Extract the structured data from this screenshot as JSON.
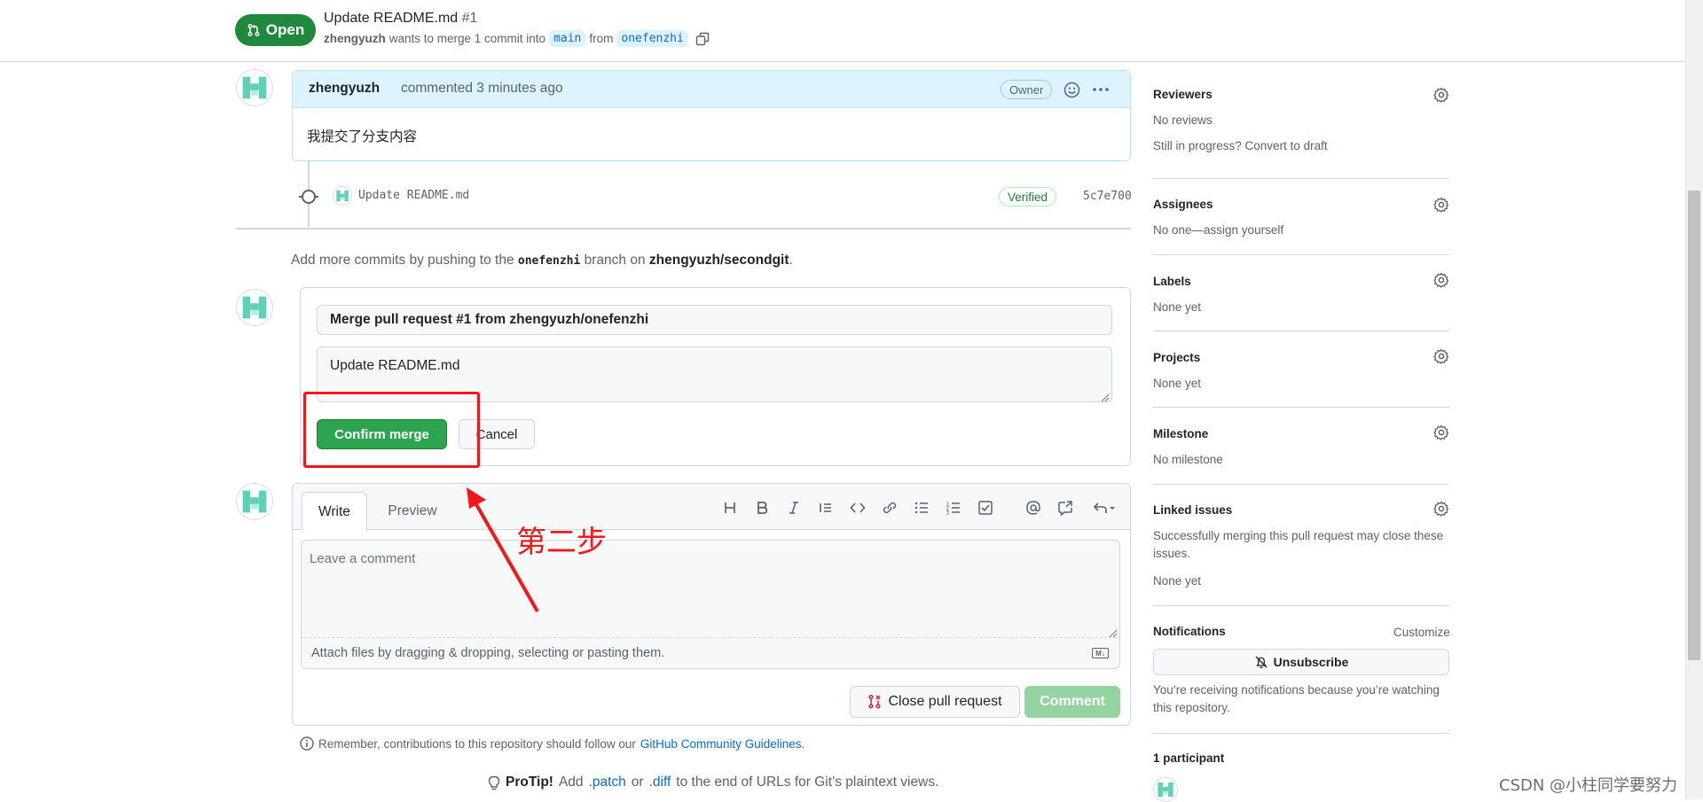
{
  "header": {
    "state": "Open",
    "title": "Update README.md",
    "number": "#1",
    "author": "zhengyuzh",
    "meta_text": "wants to merge 1 commit into",
    "base_branch": "main",
    "from_text": "from",
    "head_branch": "onefenzhi"
  },
  "comment": {
    "author": "zhengyuzh",
    "action": "commented 3 minutes ago",
    "owner_badge": "Owner",
    "body": "我提交了分支内容"
  },
  "commit": {
    "message": "Update README.md",
    "verified": "Verified",
    "sha": "5c7e700"
  },
  "push_hint": {
    "prefix": "Add more commits by pushing to the",
    "branch": "onefenzhi",
    "middle": "branch on",
    "repo": "zhengyuzh/secondgit",
    "suffix": "."
  },
  "merge": {
    "title_value": "Merge pull request #1 from zhengyuzh/onefenzhi",
    "message_value": "Update README.md",
    "confirm_label": "Confirm merge",
    "cancel_label": "Cancel"
  },
  "editor": {
    "tab_write": "Write",
    "tab_preview": "Preview",
    "placeholder": "Leave a comment",
    "attach_text": "Attach files by dragging & dropping, selecting or pasting them.",
    "markdown_icon_text": "M↓",
    "close_label": "Close pull request",
    "comment_label": "Comment",
    "toolbar": [
      "heading-icon",
      "bold-icon",
      "italic-icon",
      "quote-icon",
      "code-icon",
      "link-icon",
      "unordered-list-icon",
      "ordered-list-icon",
      "task-list-icon",
      "mention-icon",
      "reference-icon",
      "reply-icon"
    ]
  },
  "footer": {
    "guidelines_prefix": "Remember, contributions to this repository should follow our",
    "guidelines_link": "GitHub Community Guidelines",
    "guidelines_suffix": ".",
    "protip_label": "ProTip!",
    "protip_add": "Add",
    "protip_patch": ".patch",
    "protip_or": "or",
    "protip_diff": ".diff",
    "protip_rest": "to the end of URLs for Git’s plaintext views."
  },
  "annotation": {
    "text": "第二步",
    "color": "#f0191a"
  },
  "sidebar": {
    "reviewers_title": "Reviewers",
    "reviewers_value": "No reviews",
    "reviewers_draft": "Still in progress? Convert to draft",
    "assignees_title": "Assignees",
    "assignees_value": "No one—assign yourself",
    "labels_title": "Labels",
    "labels_value": "None yet",
    "projects_title": "Projects",
    "projects_value": "None yet",
    "milestone_title": "Milestone",
    "milestone_value": "No milestone",
    "linked_title": "Linked issues",
    "linked_desc": "Successfully merging this pull request may close these issues.",
    "linked_value": "None yet",
    "notifications_title": "Notifications",
    "notifications_customize": "Customize",
    "unsubscribe_label": "Unsubscribe",
    "notifications_desc": "You’re receiving notifications because you’re watching this repository.",
    "participants_title": "1 participant"
  },
  "watermark": "CSDN @小柱同学要努力",
  "colors": {
    "open_green": "#1f883d",
    "merge_green": "#2da44e",
    "link_blue": "#0969da",
    "avatar_teal": "#5fd1b6"
  }
}
